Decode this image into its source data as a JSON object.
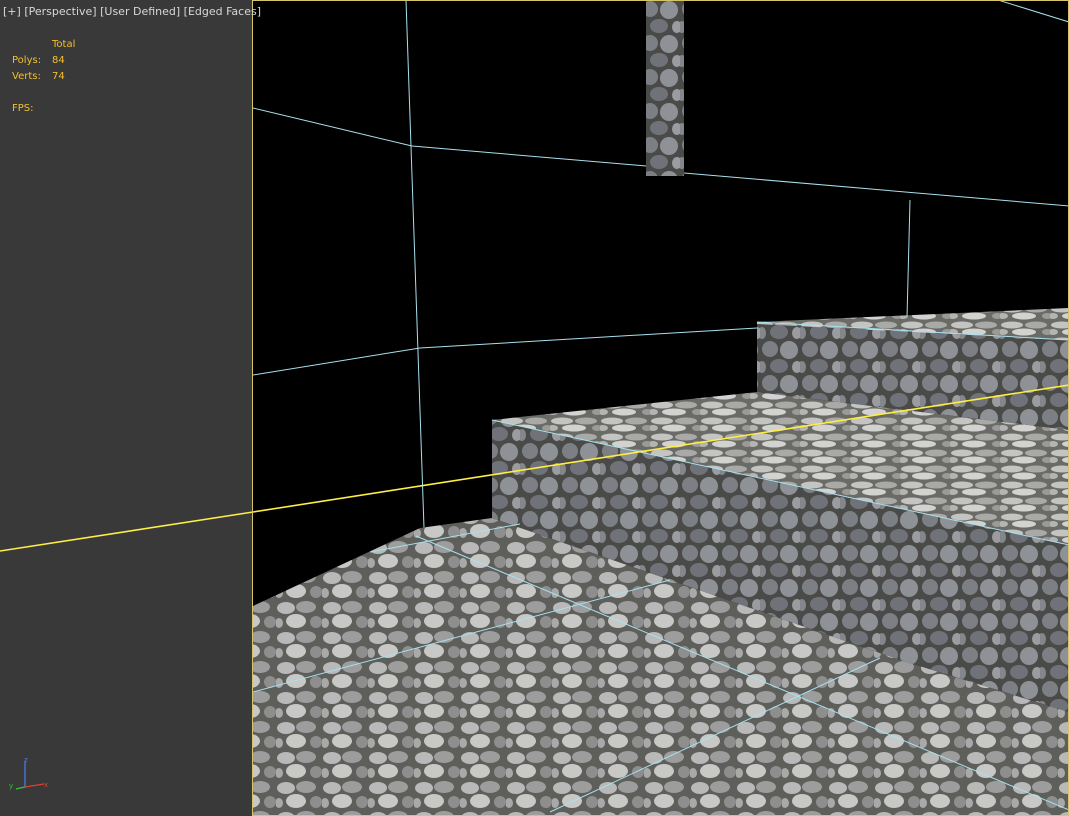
{
  "viewport_label": {
    "plus": "[+]",
    "projection": "[Perspective]",
    "shading": "[User Defined]",
    "edges": "[Edged Faces]"
  },
  "stats": {
    "header": "Total",
    "polys_label": "Polys:",
    "polys_value": "84",
    "verts_label": "Verts:",
    "verts_value": "74",
    "fps_label": "FPS:"
  },
  "axis_gizmo": {
    "x": "x",
    "y": "y",
    "z": "z"
  },
  "colors": {
    "panel_bg": "#393939",
    "viewport_bg": "#000000",
    "active_border": "#d6c36a",
    "stats_text": "#f0c030",
    "wire_edges": "#a8e0ee",
    "selected_edge": "#ffee44",
    "stone": "#8c8c8c"
  }
}
